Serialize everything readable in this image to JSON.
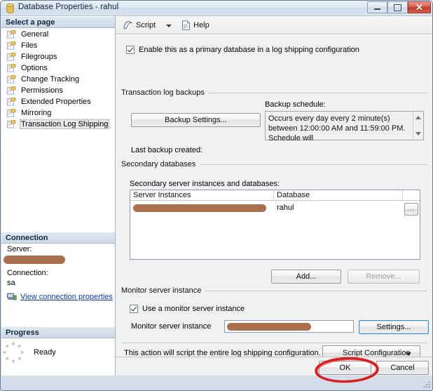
{
  "window": {
    "title": "Database Properties - rahul",
    "icon": "database-icon",
    "controls": {
      "minimize": "minimize-icon",
      "maximize": "maximize-icon",
      "close": "close-icon"
    }
  },
  "sidebar": {
    "select_page_header": "Select a page",
    "items": [
      {
        "label": "General",
        "selected": false
      },
      {
        "label": "Files",
        "selected": false
      },
      {
        "label": "Filegroups",
        "selected": false
      },
      {
        "label": "Options",
        "selected": false
      },
      {
        "label": "Change Tracking",
        "selected": false
      },
      {
        "label": "Permissions",
        "selected": false
      },
      {
        "label": "Extended Properties",
        "selected": false
      },
      {
        "label": "Mirroring",
        "selected": false
      },
      {
        "label": "Transaction Log Shipping",
        "selected": true
      }
    ],
    "connection": {
      "header": "Connection",
      "server_label": "Server:",
      "server_value": "",
      "connection_label": "Connection:",
      "connection_value": "sa",
      "view_properties_link": "View connection properties"
    },
    "progress": {
      "header": "Progress",
      "status": "Ready"
    }
  },
  "toolbar": {
    "script_label": "Script",
    "help_label": "Help"
  },
  "main": {
    "enable_checkbox_label": "Enable this as a primary database in a log shipping configuration",
    "enable_checkbox_checked": true,
    "transaction_log_backups": {
      "group_title": "Transaction log backups",
      "backup_settings_button": "Backup Settings...",
      "backup_schedule_label": "Backup schedule:",
      "backup_schedule_text": "Occurs every day every 2 minute(s) between 12:00:00 AM and 11:59:00 PM. Schedule will",
      "last_backup_created_label": "Last backup created:"
    },
    "secondary_databases": {
      "group_title": "Secondary databases",
      "grid_label": "Secondary server instances and databases:",
      "columns": [
        "Server Instances",
        "Database",
        ""
      ],
      "rows": [
        {
          "server_instance": "",
          "database": "rahul",
          "browse": "..."
        }
      ],
      "add_button": "Add...",
      "remove_button": "Remove...",
      "remove_enabled": false
    },
    "monitor_server": {
      "group_title": "Monitor server instance",
      "use_monitor_checkbox_label": "Use a monitor server instance",
      "use_monitor_checked": true,
      "monitor_instance_label": "Monitor server instance",
      "monitor_instance_value": "",
      "settings_button": "Settings..."
    },
    "script_action": {
      "text": "This action will script the entire log shipping configuration.",
      "script_configuration_button": "Script Configuration"
    }
  },
  "footer": {
    "ok_button": "OK",
    "cancel_button": "Cancel"
  },
  "annotation": {
    "shape": "red-ellipse-highlight",
    "color": "#d81f1f",
    "target": "OK"
  },
  "colors": {
    "redaction": "#a9704e",
    "link": "#0f37b0",
    "title_bar": "#dce7f2",
    "close_button": "#c03a28"
  }
}
